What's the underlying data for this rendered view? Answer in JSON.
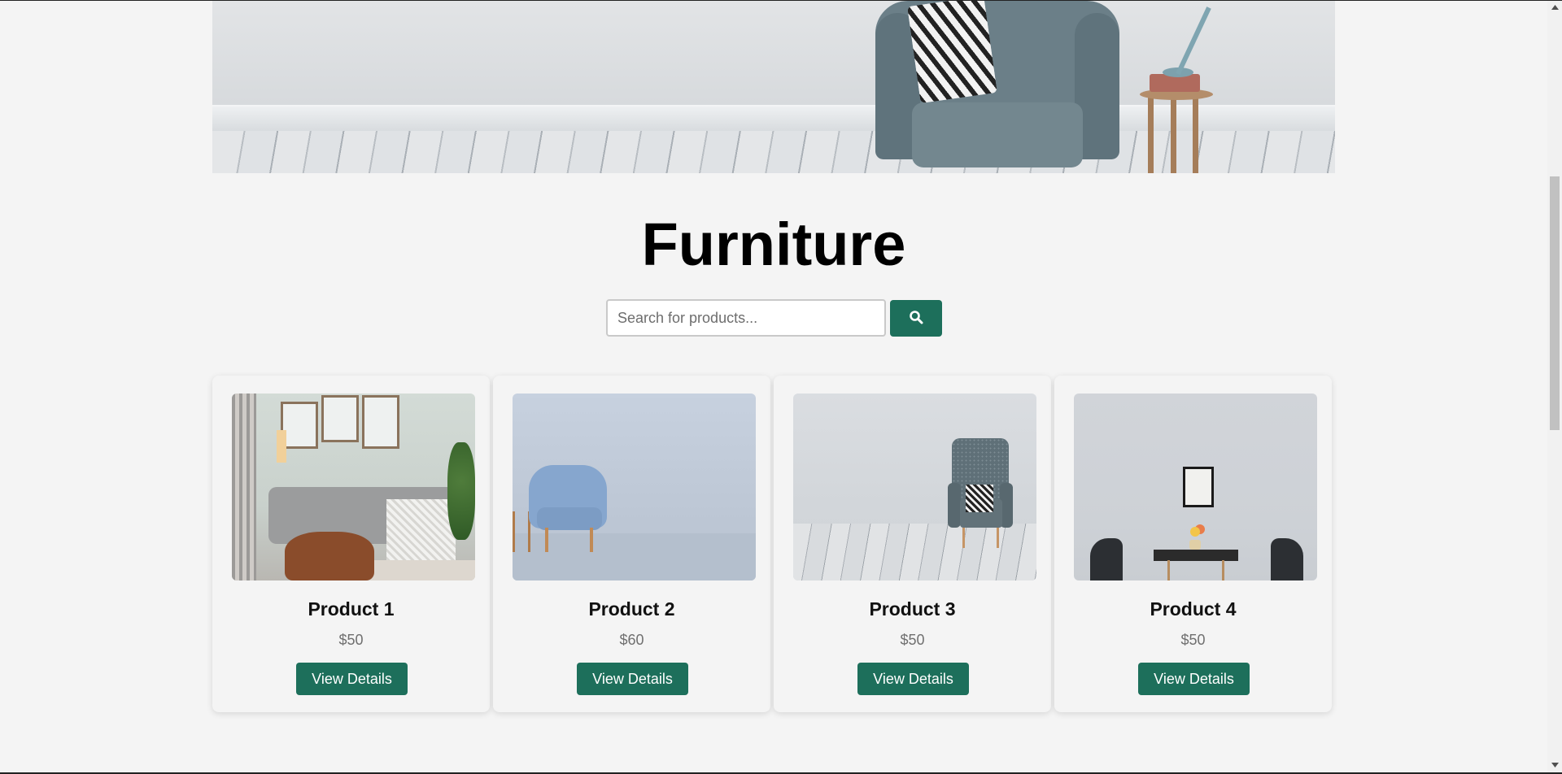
{
  "page": {
    "title": "Furniture"
  },
  "search": {
    "placeholder": "Search for products...",
    "button_icon": "search-icon"
  },
  "products": [
    {
      "name": "Product 1",
      "price": "$50",
      "button_label": "View Details"
    },
    {
      "name": "Product 2",
      "price": "$60",
      "button_label": "View Details"
    },
    {
      "name": "Product 3",
      "price": "$50",
      "button_label": "View Details"
    },
    {
      "name": "Product 4",
      "price": "$50",
      "button_label": "View Details"
    }
  ],
  "colors": {
    "accent": "#1d6f5b",
    "background": "#f4f4f4",
    "price_text": "#6f6f6f"
  }
}
